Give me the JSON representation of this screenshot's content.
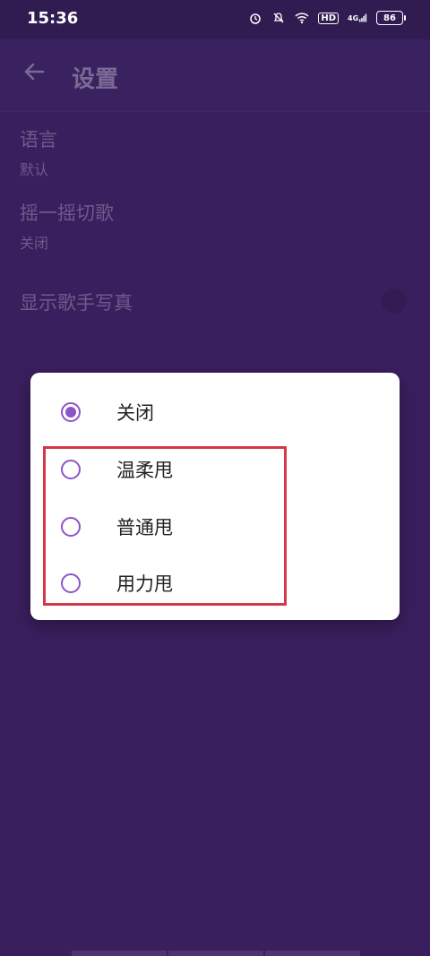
{
  "status_bar": {
    "time": "15:36",
    "icons": [
      "alarm-icon",
      "mute-icon",
      "wifi-icon",
      "hd-icon",
      "4g-signal-icon",
      "battery-icon"
    ],
    "hd_label": "HD",
    "network_label": "4G",
    "battery": "86"
  },
  "app_bar": {
    "title": "设置",
    "back_icon": "arrow-left-icon"
  },
  "settings": [
    {
      "name": "语言",
      "value": "默认"
    },
    {
      "name": "摇一摇切歌",
      "value": "关闭"
    },
    {
      "name": "显示歌手写真"
    }
  ],
  "dialog": {
    "options": [
      {
        "label": "关闭",
        "checked": true
      },
      {
        "label": "温柔甩",
        "checked": false
      },
      {
        "label": "普通甩",
        "checked": false
      },
      {
        "label": "用力甩",
        "checked": false
      }
    ]
  },
  "colors": {
    "background": "#3a1f5e",
    "accent": "#8d54c9",
    "highlight": "#d43747"
  }
}
